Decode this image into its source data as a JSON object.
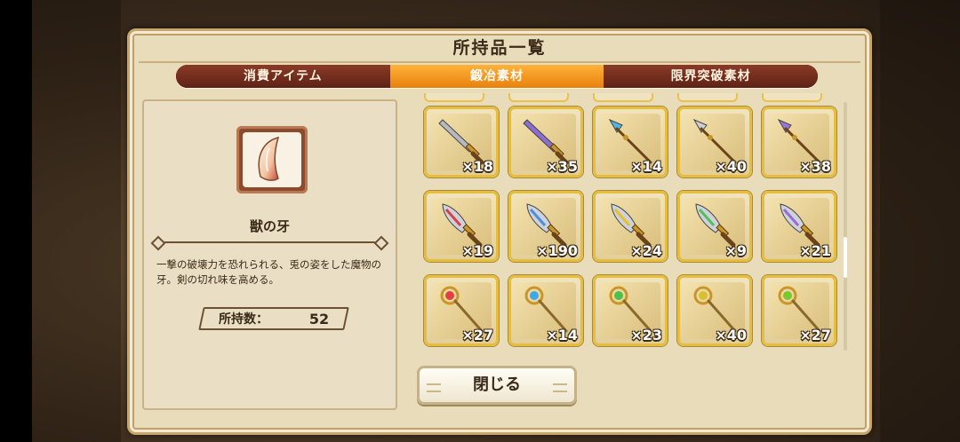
{
  "window": {
    "title": "所持品一覧"
  },
  "tabs": [
    {
      "label": "消費アイテム",
      "active": false
    },
    {
      "label": "鍛冶素材",
      "active": true
    },
    {
      "label": "限界突破素材",
      "active": false
    }
  ],
  "detail": {
    "icon": "fang-icon",
    "name": "獣の牙",
    "description": "一撃の破壊力を恐れられる、兎の姿をした魔物の牙。剣の切れ味を高める。",
    "owned_label": "所持数：",
    "owned_value": "52"
  },
  "grid": [
    [
      {
        "icon": "bronze-sword-icon",
        "qty": "×18",
        "color": "#b8b8c0"
      },
      {
        "icon": "purple-sword-icon",
        "qty": "×35",
        "color": "#8a6fd0"
      },
      {
        "icon": "blue-spear-icon",
        "qty": "×14",
        "color": "#4fb6e8"
      },
      {
        "icon": "red-spear-icon",
        "qty": "×40",
        "color": "#cfcfd6"
      },
      {
        "icon": "purple-spear-icon",
        "qty": "×38",
        "color": "#9a78d8"
      }
    ],
    [
      {
        "icon": "red-dagger-icon",
        "qty": "×19",
        "color": "#d8404a"
      },
      {
        "icon": "blue-dagger-icon",
        "qty": "×190",
        "color": "#4a8ee0"
      },
      {
        "icon": "yellow-dagger-icon",
        "qty": "×24",
        "color": "#e6c02a"
      },
      {
        "icon": "green-dagger-icon",
        "qty": "×9",
        "color": "#4fc05a"
      },
      {
        "icon": "violet-dagger-icon",
        "qty": "×21",
        "color": "#9a6ad8"
      }
    ],
    [
      {
        "icon": "red-staff-icon",
        "qty": "×27",
        "color": "#e04040"
      },
      {
        "icon": "blue-staff-icon",
        "qty": "×14",
        "color": "#40a8e8"
      },
      {
        "icon": "green-staff-icon",
        "qty": "×23",
        "color": "#4cc04c"
      },
      {
        "icon": "gold-scepter-icon",
        "qty": "×40",
        "color": "#d8c030"
      },
      {
        "icon": "green-scepter-icon",
        "qty": "×27",
        "color": "#78c830"
      }
    ]
  ],
  "close_button": {
    "label": "閉じる"
  }
}
